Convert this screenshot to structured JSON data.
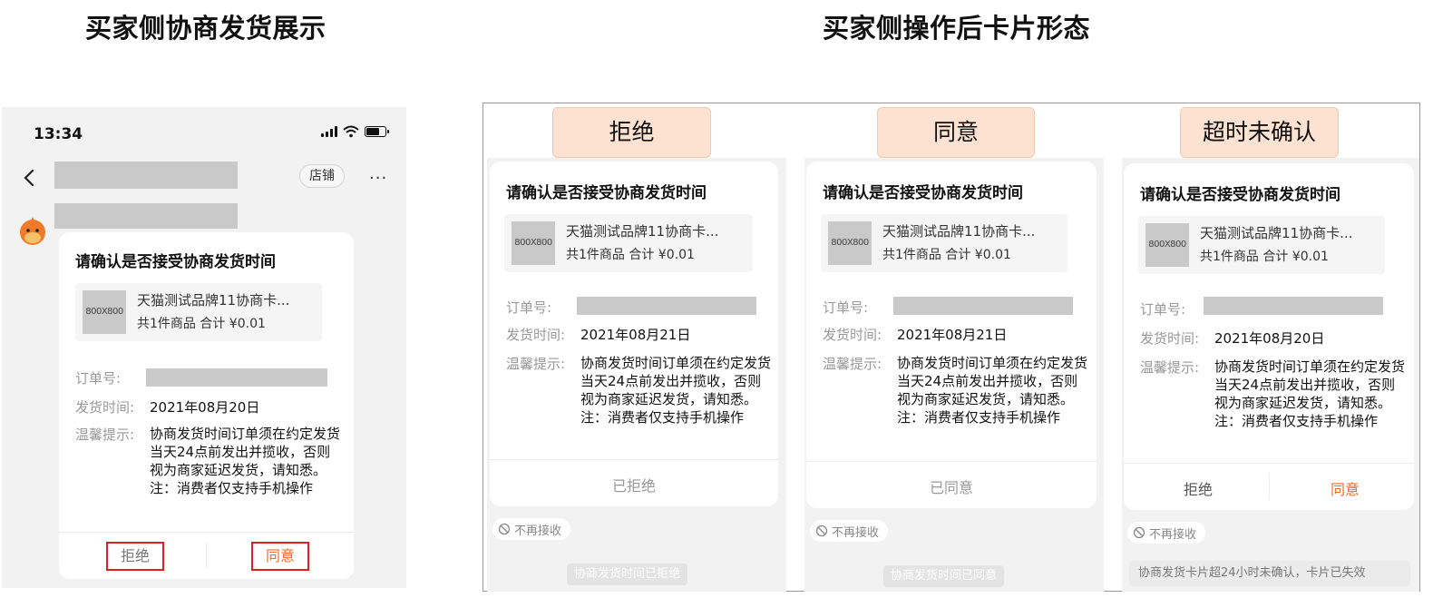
{
  "headings": {
    "left": "买家侧协商发货展示",
    "right": "买家侧操作后卡片形态"
  },
  "phone": {
    "status_time": "13:34",
    "shop_label": "店铺",
    "more_label": "···",
    "card": {
      "title": "请确认是否接受协商发货时间",
      "thumb_label": "800X800",
      "product_name": "天猫测试品牌11协商卡...",
      "product_meta": "共1件商品  合计 ¥0.01",
      "order_label": "订单号:",
      "ship_label": "发货时间:",
      "ship_value": "2021年08月20日",
      "tip_label": "温馨提示:",
      "tip_text": "协商发货时间订单须在约定发货当天24点前发出并揽收，否则视为商家延迟发货，请知悉。注：消费者仅支持手机操作",
      "reject_label": "拒绝",
      "agree_label": "同意"
    }
  },
  "states": [
    {
      "status": "拒绝",
      "title": "请确认是否接受协商发货时间",
      "thumb_label": "800X800",
      "product_name": "天猫测试品牌11协商卡...",
      "product_meta": "共1件商品  合计 ¥0.01",
      "order_label": "订单号:",
      "ship_label": "发货时间:",
      "ship_value": "2021年08月21日",
      "tip_label": "温馨提示:",
      "tip_text": "协商发货时间订单须在约定发货当天24点前发出并揽收，否则视为商家延迟发货，请知悉。注：消费者仅支持手机操作",
      "footer_label": "已拒绝",
      "no_receive": "不再接收",
      "system_msg": "协商发货时间已拒绝"
    },
    {
      "status": "同意",
      "title": "请确认是否接受协商发货时间",
      "thumb_label": "800X800",
      "product_name": "天猫测试品牌11协商卡...",
      "product_meta": "共1件商品  合计 ¥0.01",
      "order_label": "订单号:",
      "ship_label": "发货时间:",
      "ship_value": "2021年08月21日",
      "tip_label": "温馨提示:",
      "tip_text": "协商发货时间订单须在约定发货当天24点前发出并揽收，否则视为商家延迟发货，请知悉。注：消费者仅支持手机操作",
      "footer_label": "已同意",
      "no_receive": "不再接收",
      "system_msg": "协商发货时间已同意"
    },
    {
      "status": "超时未确认",
      "title": "请确认是否接受协商发货时间",
      "thumb_label": "800X800",
      "product_name": "天猫测试品牌11协商卡...",
      "product_meta": "共1件商品  合计 ¥0.01",
      "order_label": "订单号:",
      "ship_label": "发货时间:",
      "ship_value": "2021年08月20日",
      "tip_label": "温馨提示:",
      "tip_text": "协商发货时间订单须在约定发货当天24点前发出并揽收，否则视为商家延迟发货，请知悉。注：消费者仅支持手机操作",
      "reject_label": "拒绝",
      "agree_label": "同意",
      "no_receive": "不再接收",
      "system_msg": "协商发货卡片超24小时未确认，卡片已失效"
    }
  ],
  "colors": {
    "accent_orange": "#f26b2a",
    "highlight_red": "#e02020",
    "status_box": "#fde2d1"
  }
}
